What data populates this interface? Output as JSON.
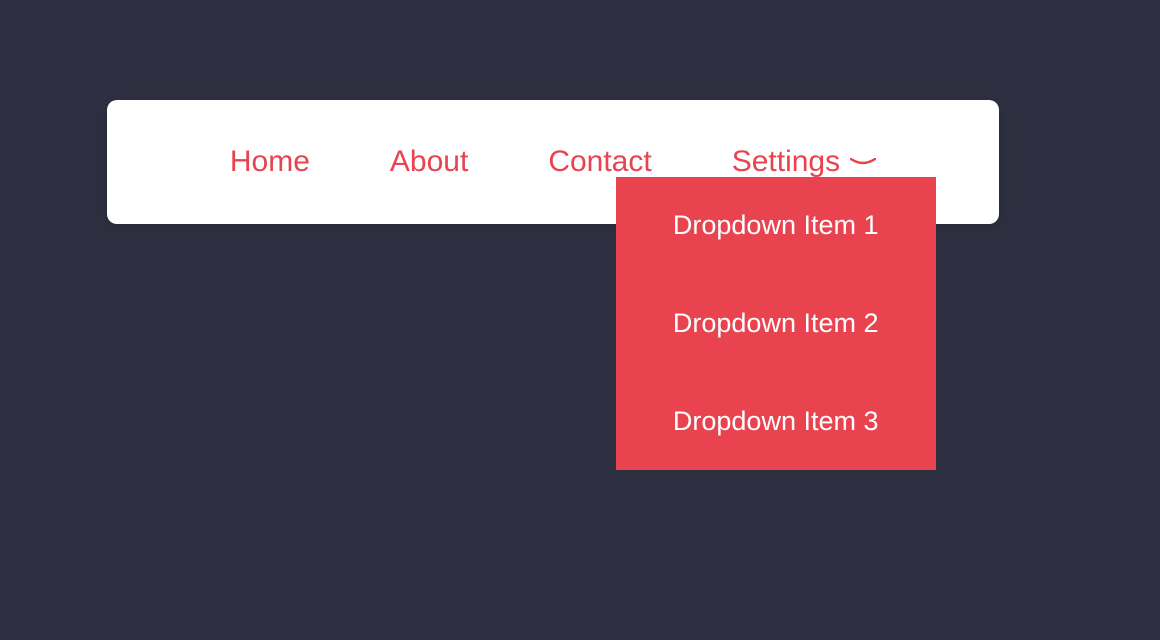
{
  "nav": {
    "items": [
      {
        "label": "Home"
      },
      {
        "label": "About"
      },
      {
        "label": "Contact"
      },
      {
        "label": "Settings"
      }
    ],
    "dropdown": {
      "items": [
        {
          "label": "Dropdown Item 1"
        },
        {
          "label": "Dropdown Item 2"
        },
        {
          "label": "Dropdown Item 3"
        }
      ]
    }
  },
  "colors": {
    "background": "#2e3041",
    "accent": "#e8434f",
    "navbar": "#ffffff"
  }
}
